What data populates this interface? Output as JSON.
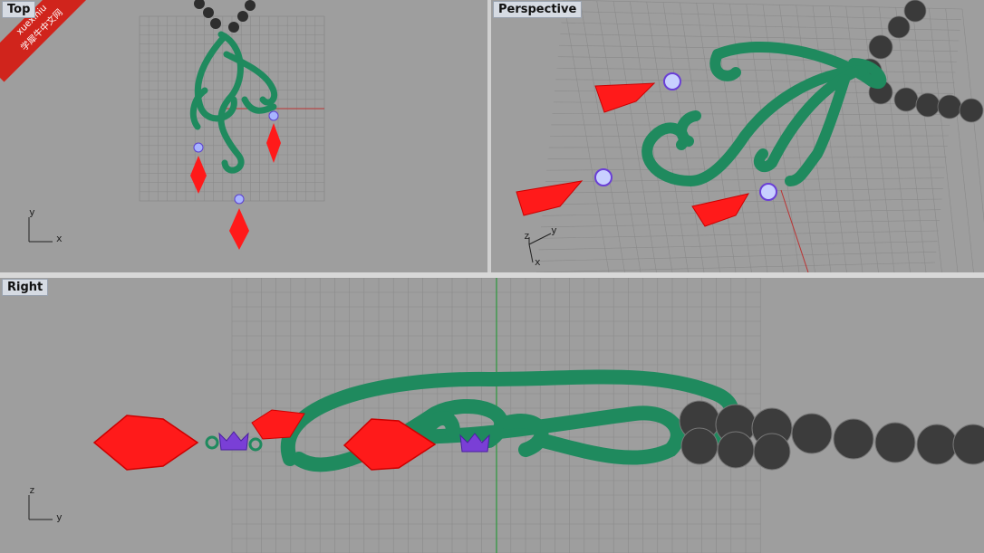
{
  "viewports": {
    "top": {
      "title": "Top",
      "axis_x": "x",
      "axis_y": "y"
    },
    "perspective": {
      "title": "Perspective",
      "axis_x": "x",
      "axis_y": "y",
      "axis_z": "z"
    },
    "right": {
      "title": "Right",
      "axis_x": "y",
      "axis_y": "z"
    }
  },
  "watermark": {
    "line1": "xuexiniu",
    "line2": "学犀牛中文网"
  },
  "colors": {
    "viewport_bg": "#9e9e9e",
    "grid": "#8c8c8c",
    "frame_green": "#1f8a5e",
    "gem_red": "#ff1a1a",
    "setting_purple": "#7a3fd6",
    "pearl": "#3a3a3a"
  }
}
